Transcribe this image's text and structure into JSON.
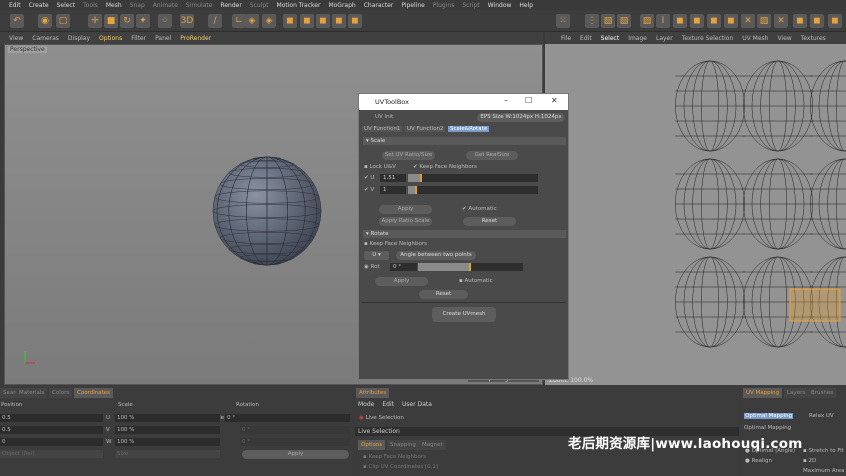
{
  "menu": [
    "Edit",
    "Create",
    "Select",
    "Tools",
    "Mesh",
    "Snap",
    "Animate",
    "Simulate",
    "Render",
    "Sculpt",
    "Motion Tracker",
    "MoGraph",
    "Character",
    "Pipeline",
    "Plugins",
    "Script",
    "Window",
    "Help"
  ],
  "viewport": {
    "menu": [
      "View",
      "Cameras",
      "Display",
      "Options",
      "Filter",
      "Panel",
      "ProRender"
    ],
    "label": "Perspective",
    "grid_spacing": "Grid Spacing : 100 cm"
  },
  "uv_editor": {
    "menu": [
      "File",
      "Edit",
      "Select",
      "Image",
      "Layer",
      "Texture Selection",
      "UV Mesh",
      "View",
      "Textures"
    ],
    "zoom": "Zoom: 100.0%"
  },
  "dialog": {
    "title": "UVToolBox",
    "uv_init": "UV Init",
    "eps_size": "EPS Size W:1024px H:1024px",
    "tabs": [
      "UV Function1",
      "UV Function2",
      "Scale&Rotate"
    ],
    "scale": {
      "header": "Scale",
      "set_uv_ratio": "Set UV Ratio/Size",
      "get_realsize": "Get RealSize",
      "lock_uv": "Lock U&V",
      "keep_face_neighbors": "Keep Face Neighbors",
      "u_label": "U",
      "u_value": "1.51",
      "u_fill": 0.11,
      "v_label": "V",
      "v_value": "1",
      "v_fill": 0.07,
      "apply": "Apply",
      "automatic": "Automatic",
      "apply_ratio_scale": "Apply Ratio Scale",
      "reset": "Reset"
    },
    "rotate": {
      "header": "Rotate",
      "keep_face_neighbors": "Keep Face Neighbors",
      "axis": "U",
      "angle_btn": "Angle between two points",
      "rot_label": "Rot",
      "rot_value": "0 °",
      "rot_fill": 0.5,
      "apply": "Apply",
      "automatic": "Automatic",
      "reset": "Reset"
    },
    "create_uvmesh": "Create UVmesh"
  },
  "coords": {
    "tabs": [
      "Search",
      "Materials",
      "Colors",
      "Coordinates"
    ],
    "position": "Position",
    "scale": "Scale",
    "rotation": "Rotation",
    "rows": [
      {
        "pos": "0.5",
        "axis": "U",
        "scale": "100 %"
      },
      {
        "pos": "0.5",
        "axis": "V",
        "scale": "100 %"
      },
      {
        "pos": "0",
        "axis": "W",
        "scale": "100 %"
      }
    ],
    "angle_label": "Angle",
    "angle": "0 °",
    "angle2": "0 °",
    "angle3": "0 °",
    "pos_mode": "Object (Rel)",
    "scale_mode": "Size",
    "apply": "Apply"
  },
  "attributes": {
    "tab": "Attributes",
    "menu": [
      "Mode",
      "Edit",
      "User Data"
    ],
    "tool": "Live Selection",
    "section": "Live Selection",
    "subtabs": [
      "Options",
      "Snapping",
      "Magnet"
    ],
    "opts": [
      "Keep Face Neighbors",
      "Clip UV Coordinates [0,1]"
    ]
  },
  "uv_mapping": {
    "tabs": [
      "UV Mapping",
      "Layers",
      "Brushes"
    ],
    "subtabs": [
      "Optimal Mapping",
      "Relax UV"
    ],
    "heading": "Optimal Mapping",
    "items": [
      "Optimal (Angle)",
      "Realign"
    ],
    "right": [
      "Stretch to Fit",
      "2D",
      "Maximum Area"
    ]
  },
  "watermark": "老后期资源库|www.laohouqi.com"
}
